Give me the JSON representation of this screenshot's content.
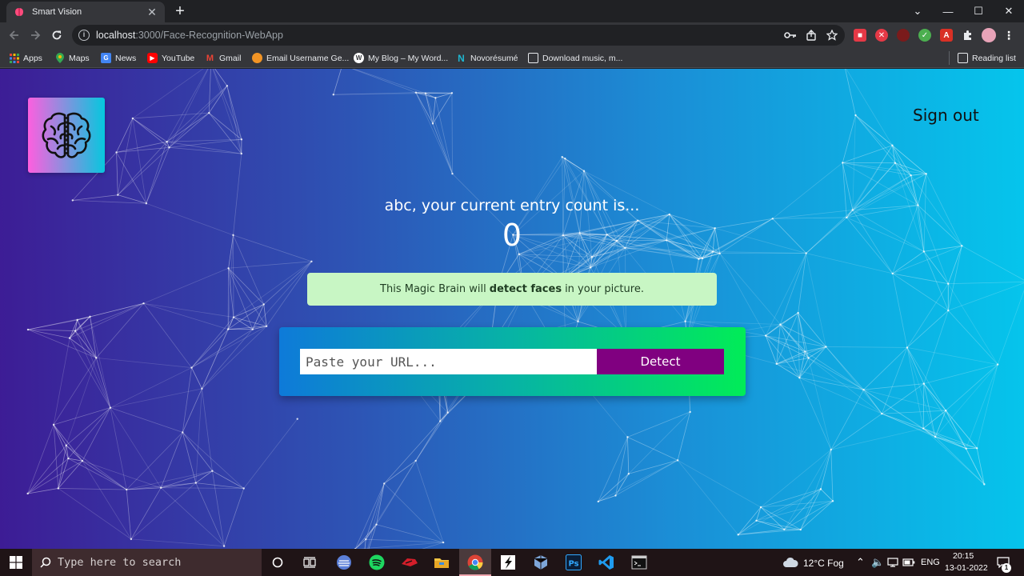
{
  "browser": {
    "tab_title": "Smart Vision",
    "tab_close": "✕",
    "new_tab": "+",
    "url_host": "localhost",
    "url_path": ":3000/Face-Recognition-WebApp",
    "window_controls": {
      "minimize": "—",
      "maximize": "☐",
      "close": "✕",
      "tabs_menu": "⌄"
    }
  },
  "bookmarks": [
    {
      "label": "Apps",
      "icon": "apps-grid-icon",
      "color": "#e8a33a"
    },
    {
      "label": "Maps",
      "icon": "maps-pin-icon",
      "color": "#34a853"
    },
    {
      "label": "News",
      "icon": "news-icon",
      "color": "#4285f4"
    },
    {
      "label": "YouTube",
      "icon": "youtube-icon",
      "color": "#ff0000"
    },
    {
      "label": "Gmail",
      "icon": "gmail-icon",
      "color": "#ea4335"
    },
    {
      "label": "Email Username Ge...",
      "icon": "fox-icon",
      "color": "#f29425"
    },
    {
      "label": "My Blog – My Word...",
      "icon": "wordpress-icon",
      "color": "#ffffff"
    },
    {
      "label": "Novorésumé",
      "icon": "novoresume-icon",
      "color": "#1fb6d0"
    },
    {
      "label": "Download music, m...",
      "icon": "download-page-icon",
      "color": "#ffffff"
    }
  ],
  "reading_list": "Reading list",
  "app": {
    "sign_out": "Sign out",
    "entry_text": "abc, your current entry count is...",
    "entry_count": "0",
    "info_prefix": "This Magic Brain will",
    "info_bold": "detect faces",
    "info_suffix": "in your picture.",
    "url_placeholder": "Paste your URL...",
    "detect_label": "Detect"
  },
  "taskbar": {
    "search_placeholder": "Type here to search",
    "weather": "12°C  Fog",
    "language": "ENG",
    "time": "20:15",
    "date": "13-01-2022",
    "notification_count": "1"
  }
}
